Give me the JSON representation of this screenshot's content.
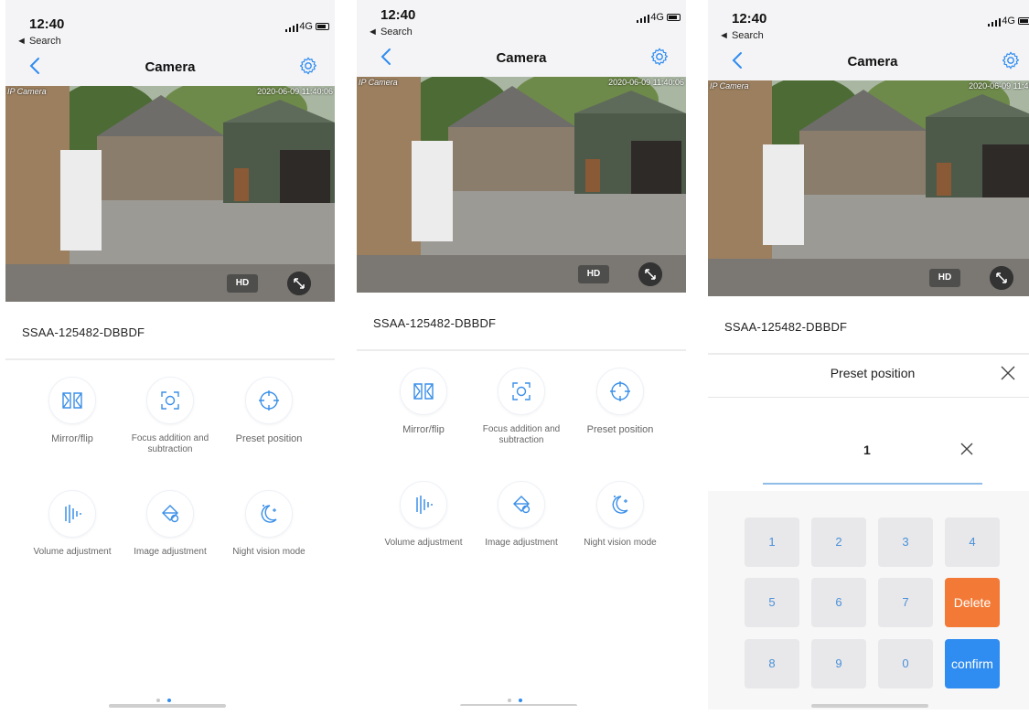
{
  "status_bar": {
    "time": "12:40",
    "back_app": "◄ Search",
    "network": "4G"
  },
  "navbar": {
    "title": "Camera"
  },
  "video": {
    "camera_label": "IP Camera",
    "timestamp_1": "2020-06-09 11:40:06",
    "timestamp_2": "2020-06-09 11:40:06",
    "timestamp_3": "2020-06-09 11:40:",
    "hd_label": "HD"
  },
  "device": {
    "id": "SSAA-125482-DBBDF"
  },
  "tools": [
    {
      "label": "Mirror/flip",
      "icon": "mirror-flip-icon"
    },
    {
      "label": "Focus addition and subtraction",
      "icon": "focus-icon"
    },
    {
      "label": "Preset position",
      "icon": "crosshair-icon"
    },
    {
      "label": "Volume adjustment",
      "icon": "volume-icon"
    },
    {
      "label": "Image adjustment",
      "icon": "image-adjust-icon"
    },
    {
      "label": "Night vision mode",
      "icon": "night-vision-icon"
    }
  ],
  "pager": {
    "total": 2,
    "active": 2
  },
  "preset_panel": {
    "title": "Preset position",
    "value": "1",
    "keys": [
      "1",
      "2",
      "3",
      "4",
      "5",
      "6",
      "7",
      "8",
      "9",
      "0"
    ],
    "delete_label": "Delete",
    "confirm_label": "confirm"
  },
  "colors": {
    "accent": "#2f8cf0",
    "delete": "#f37a36",
    "key_bg": "#e8e8ea"
  }
}
